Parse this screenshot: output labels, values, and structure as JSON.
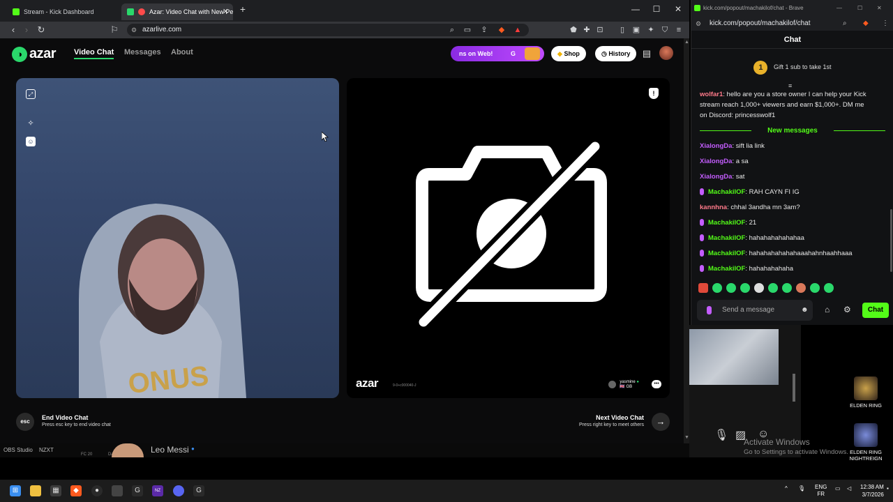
{
  "browser1": {
    "tabs": [
      {
        "title": "Stream - Kick Dashboard"
      },
      {
        "title": "Azar: Video Chat with New Pe"
      }
    ],
    "url": "azarlive.com"
  },
  "azar": {
    "logo_text": "azar",
    "nav": [
      "Video Chat",
      "Messages",
      "About"
    ],
    "promo": "ns on Web!",
    "promo_g": "G",
    "shop_label": "Shop",
    "history_label": "History",
    "watermark": "azar",
    "watermark_code": "9-0+c000040-J",
    "remote_user": "yasmine",
    "remote_country": "GB",
    "end_title": "End Video Chat",
    "end_sub": "Press esc key to end video chat",
    "esc_label": "esc",
    "next_title": "Next Video Chat",
    "next_sub": "Press right key to meet others"
  },
  "browser2": {
    "window_title": "kick.com/popout/machakilof/chat - Brave",
    "url": "kick.com/popout/machakilof/chat",
    "chat_header": "Chat",
    "gift_number": "1",
    "gift_text": "Gift 1 sub to take 1st",
    "pinned_user": "wolfar1",
    "pinned_lines": [
      ": hello are you a store owner I can help your Kick",
      "stream reach 1,000+ viewers and earn $1,000+. DM me",
      "on Discord: princesswolf1"
    ],
    "new_messages_label": "New messages",
    "messages": [
      {
        "user": "XialongDa",
        "color": "#c45dff",
        "text": ": sift lia link",
        "badge": false
      },
      {
        "user": "XialongDa",
        "color": "#c45dff",
        "text": ": a sa",
        "badge": false
      },
      {
        "user": "XialongDa",
        "color": "#c45dff",
        "text": ": sat",
        "badge": false
      },
      {
        "user": "MachakilOF",
        "color": "#53fc18",
        "text": ": RAH CAYN FI IG",
        "badge": true
      },
      {
        "user": "kannhna",
        "color": "#ff7a8a",
        "text": ": chhal 3andha mn 3am?",
        "badge": false
      },
      {
        "user": "MachakilOF",
        "color": "#53fc18",
        "text": ": 21",
        "badge": true
      },
      {
        "user": "MachakilOF",
        "color": "#53fc18",
        "text": ": hahahahahahahaa",
        "badge": true
      },
      {
        "user": "MachakilOF",
        "color": "#53fc18",
        "text": ": hahahahahahahaaahahnhaahhaaa",
        "badge": true
      },
      {
        "user": "MachakilOF",
        "color": "#53fc18",
        "text": ": hahahahahaha",
        "badge": true
      }
    ],
    "send_placeholder": "Send a message",
    "chat_button": "Chat"
  },
  "taskbar_strip": {
    "obs": "OBS Studio",
    "nzxt": "NZXT",
    "fc": "FC 20",
    "dawn": "Dawn",
    "leo": "Leo Messi"
  },
  "desktop": {
    "icon1": "ELDEN RING",
    "icon2a": "ELDEN RING",
    "icon2b": "NIGHTREIGN",
    "activate_title": "Activate Windows",
    "activate_sub": "Go to Settings to activate Windows."
  },
  "tray": {
    "lang1": "ENG",
    "lang2": "FR",
    "time": "12:38 AM",
    "date": "3/7/2026"
  }
}
